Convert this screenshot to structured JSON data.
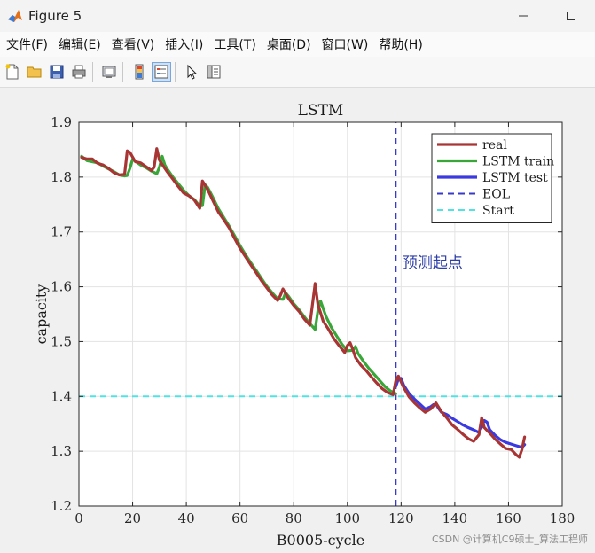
{
  "window": {
    "title": "Figure 5"
  },
  "menu": [
    {
      "label": "文件(F)"
    },
    {
      "label": "编辑(E)"
    },
    {
      "label": "查看(V)"
    },
    {
      "label": "插入(I)"
    },
    {
      "label": "工具(T)"
    },
    {
      "label": "桌面(D)"
    },
    {
      "label": "窗口(W)"
    },
    {
      "label": "帮助(H)"
    }
  ],
  "toolbar": {
    "icons": [
      "new-figure-icon",
      "open-folder-icon",
      "save-icon",
      "print-icon",
      "link-plot-icon",
      "colorbar-icon",
      "legend-icon",
      "pointer-icon",
      "property-inspector-icon"
    ]
  },
  "annotation": {
    "text": "预测起点"
  },
  "watermark": {
    "text": "CSDN @计算机C9硕士_算法工程师"
  },
  "chart_data": {
    "type": "line",
    "title": "LSTM",
    "xlabel": "B0005-cycle",
    "ylabel": "capacity",
    "xlim": [
      0,
      180
    ],
    "ylim": [
      1.2,
      1.9
    ],
    "xticks": [
      0,
      20,
      40,
      60,
      80,
      100,
      120,
      140,
      160,
      180
    ],
    "yticks": [
      1.2,
      1.3,
      1.4,
      1.5,
      1.6,
      1.7,
      1.8,
      1.9
    ],
    "grid": true,
    "legend_position": "top-right",
    "series": [
      {
        "name": "real",
        "color": "#a83434",
        "style": "solid",
        "x": [
          1,
          3,
          5,
          7,
          9,
          11,
          13,
          15,
          17,
          18,
          19,
          21,
          23,
          25,
          27,
          28,
          29,
          30,
          31,
          33,
          35,
          37,
          39,
          41,
          43,
          45,
          46,
          47,
          48,
          50,
          52,
          54,
          56,
          58,
          60,
          62,
          64,
          66,
          68,
          70,
          72,
          74,
          75,
          76,
          78,
          80,
          82,
          84,
          86,
          87,
          88,
          89,
          91,
          93,
          95,
          97,
          99,
          100,
          101,
          102,
          103,
          105,
          107,
          109,
          111,
          113,
          115,
          117,
          118,
          119,
          121,
          123,
          125,
          127,
          129,
          131,
          133,
          135,
          137,
          139,
          141,
          143,
          145,
          147,
          149,
          150,
          151,
          153,
          155,
          157,
          159,
          161,
          163,
          164,
          165,
          166
        ],
        "y": [
          1.836,
          1.833,
          1.833,
          1.825,
          1.822,
          1.816,
          1.808,
          1.804,
          1.805,
          1.848,
          1.845,
          1.828,
          1.826,
          1.819,
          1.812,
          1.818,
          1.852,
          1.831,
          1.823,
          1.809,
          1.796,
          1.783,
          1.771,
          1.766,
          1.758,
          1.743,
          1.793,
          1.785,
          1.777,
          1.756,
          1.736,
          1.722,
          1.707,
          1.688,
          1.67,
          1.655,
          1.64,
          1.626,
          1.611,
          1.598,
          1.585,
          1.575,
          1.584,
          1.596,
          1.579,
          1.566,
          1.555,
          1.541,
          1.53,
          1.568,
          1.606,
          1.568,
          1.537,
          1.522,
          1.505,
          1.492,
          1.48,
          1.493,
          1.498,
          1.486,
          1.471,
          1.457,
          1.447,
          1.435,
          1.424,
          1.414,
          1.407,
          1.403,
          1.428,
          1.437,
          1.416,
          1.399,
          1.388,
          1.379,
          1.371,
          1.377,
          1.388,
          1.372,
          1.361,
          1.348,
          1.34,
          1.331,
          1.323,
          1.318,
          1.33,
          1.361,
          1.343,
          1.333,
          1.322,
          1.313,
          1.305,
          1.303,
          1.293,
          1.289,
          1.303,
          1.326
        ]
      },
      {
        "name": "LSTM train",
        "color": "#3aa63a",
        "style": "solid",
        "x": [
          1,
          3,
          5,
          7,
          9,
          11,
          13,
          15,
          17,
          18,
          19,
          20,
          21,
          23,
          25,
          27,
          29,
          30,
          31,
          32,
          33,
          35,
          37,
          39,
          41,
          43,
          45,
          46,
          47,
          48,
          50,
          52,
          54,
          56,
          58,
          60,
          62,
          64,
          66,
          68,
          70,
          72,
          74,
          76,
          77,
          78,
          80,
          82,
          84,
          86,
          88,
          89,
          90,
          92,
          94,
          96,
          98,
          100,
          102,
          103,
          104,
          106,
          108,
          110,
          112,
          114,
          116,
          118
        ],
        "y": [
          1.838,
          1.83,
          1.828,
          1.826,
          1.82,
          1.815,
          1.81,
          1.804,
          1.802,
          1.803,
          1.816,
          1.833,
          1.829,
          1.822,
          1.817,
          1.811,
          1.806,
          1.818,
          1.838,
          1.822,
          1.814,
          1.8,
          1.788,
          1.776,
          1.766,
          1.759,
          1.747,
          1.748,
          1.786,
          1.781,
          1.762,
          1.742,
          1.726,
          1.71,
          1.693,
          1.675,
          1.659,
          1.644,
          1.63,
          1.615,
          1.601,
          1.589,
          1.578,
          1.577,
          1.589,
          1.583,
          1.569,
          1.558,
          1.545,
          1.533,
          1.522,
          1.556,
          1.574,
          1.546,
          1.526,
          1.51,
          1.495,
          1.483,
          1.484,
          1.491,
          1.478,
          1.464,
          1.451,
          1.44,
          1.429,
          1.418,
          1.41,
          1.405
        ]
      },
      {
        "name": "LSTM test",
        "color": "#3a3ae0",
        "style": "solid",
        "x": [
          118,
          119,
          120,
          121,
          123,
          125,
          127,
          129,
          131,
          132,
          133,
          134,
          135,
          137,
          139,
          141,
          143,
          145,
          147,
          149,
          150,
          151,
          152,
          153,
          155,
          157,
          159,
          161,
          163,
          165,
          166
        ],
        "y": [
          1.418,
          1.432,
          1.433,
          1.42,
          1.405,
          1.395,
          1.386,
          1.377,
          1.381,
          1.385,
          1.386,
          1.378,
          1.371,
          1.367,
          1.36,
          1.354,
          1.348,
          1.343,
          1.339,
          1.334,
          1.344,
          1.356,
          1.353,
          1.339,
          1.329,
          1.321,
          1.316,
          1.313,
          1.31,
          1.307,
          1.312
        ]
      },
      {
        "name": "EOL",
        "color": "#3a3ac8",
        "style": "dashed",
        "x": [
          118,
          118
        ],
        "y": [
          1.2,
          1.9
        ]
      },
      {
        "name": "Start",
        "color": "#4fe3e3",
        "style": "dashed",
        "x": [
          0,
          180
        ],
        "y": [
          1.4,
          1.4
        ]
      }
    ]
  }
}
